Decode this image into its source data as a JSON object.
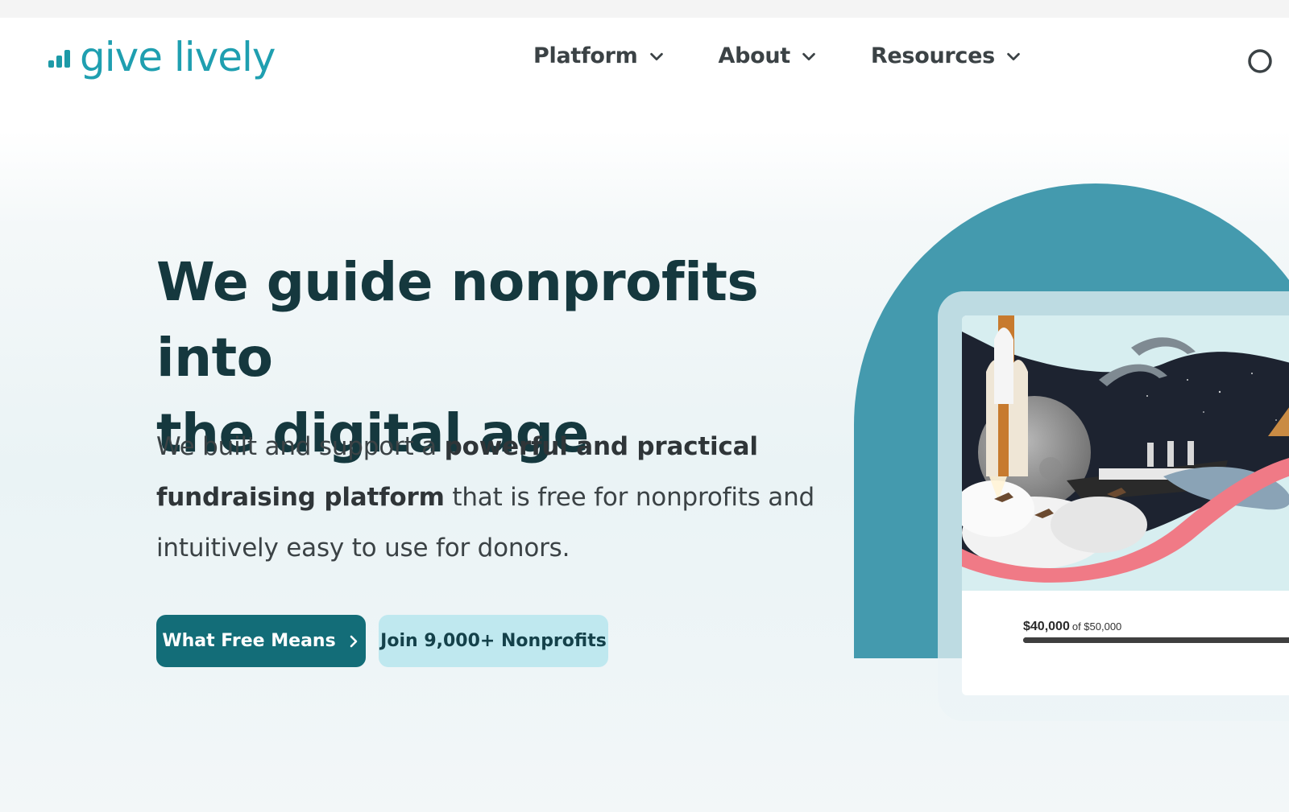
{
  "brand": {
    "name": "give lively",
    "color": "#1f9fb0"
  },
  "nav": {
    "items": [
      {
        "label": "Platform",
        "icon": "chevron-down-icon"
      },
      {
        "label": "About",
        "icon": "chevron-down-icon"
      },
      {
        "label": "Resources",
        "icon": "chevron-down-icon"
      }
    ],
    "search_icon": "search-icon"
  },
  "hero": {
    "headline_line1": "We guide nonprofits into",
    "headline_line2": "the digital age",
    "sub_prefix": "We built and support a ",
    "sub_bold": "powerful and practical fundraising platform",
    "sub_suffix": " that is free for nonprofits and intuitively easy to use for donors.",
    "primary_button": {
      "label": "What Free Means",
      "icon": "chevron-right-icon",
      "color": "#136d78"
    },
    "secondary_button": {
      "label": "Join 9,000+ Nonprofits",
      "color": "#bfe8ef"
    }
  },
  "campaign_card": {
    "raised": "$40,000",
    "goal_text": "of $50,000",
    "progress_fraction": 0.8
  },
  "colors": {
    "heading": "#15383e",
    "arch": "#449aae",
    "ribbon": "#f07a86"
  }
}
